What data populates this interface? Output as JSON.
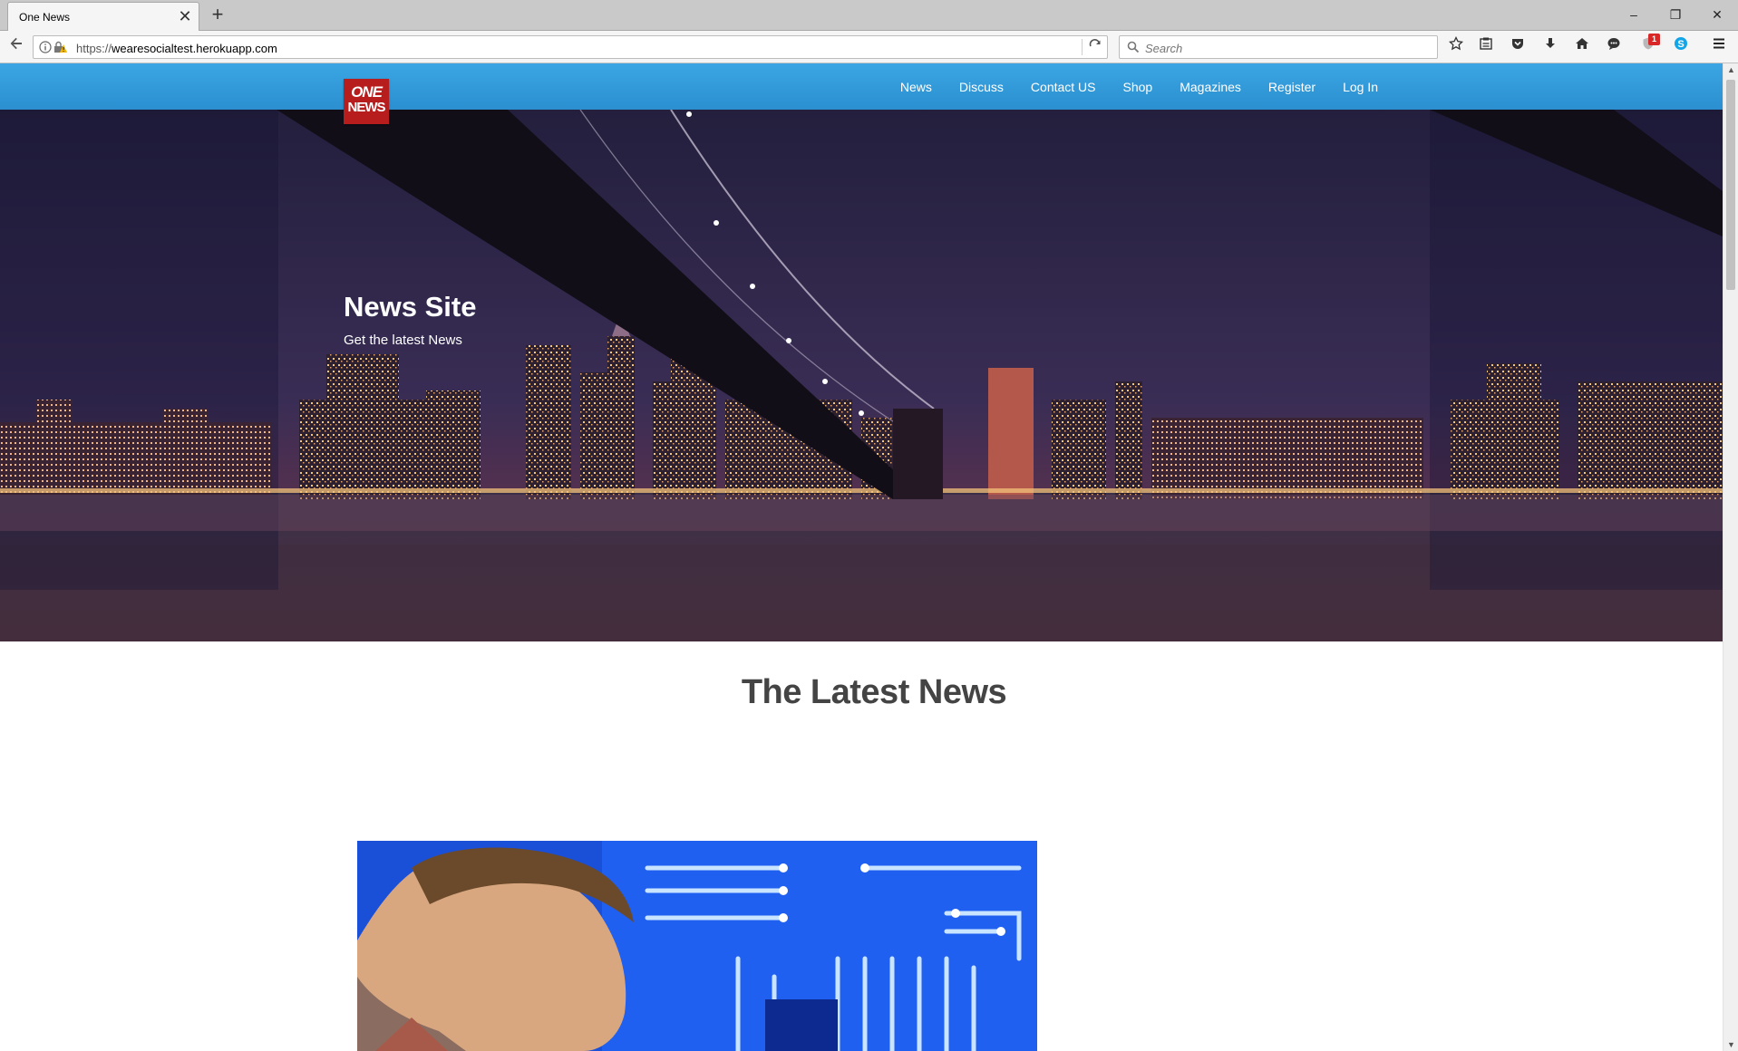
{
  "browser": {
    "tab_title": "One News",
    "tab_close": "✕",
    "new_tab": "+",
    "url_scheme": "https://",
    "url_host": "wearesocialtest.herokuapp.com",
    "search_placeholder": "Search",
    "notification_badge": "1",
    "window_controls": [
      "–",
      "❐",
      "✕"
    ]
  },
  "site": {
    "logo_line1": "ONE",
    "logo_line2": "NEWS",
    "logo_color": "#b81d1d",
    "header_color": "#3399dd",
    "nav": [
      "News",
      "Discuss",
      "Contact US",
      "Shop",
      "Magazines",
      "Register",
      "Log In"
    ]
  },
  "hero": {
    "title": "News Site",
    "subtitle": "Get the latest News"
  },
  "latest": {
    "title": "The Latest News"
  }
}
